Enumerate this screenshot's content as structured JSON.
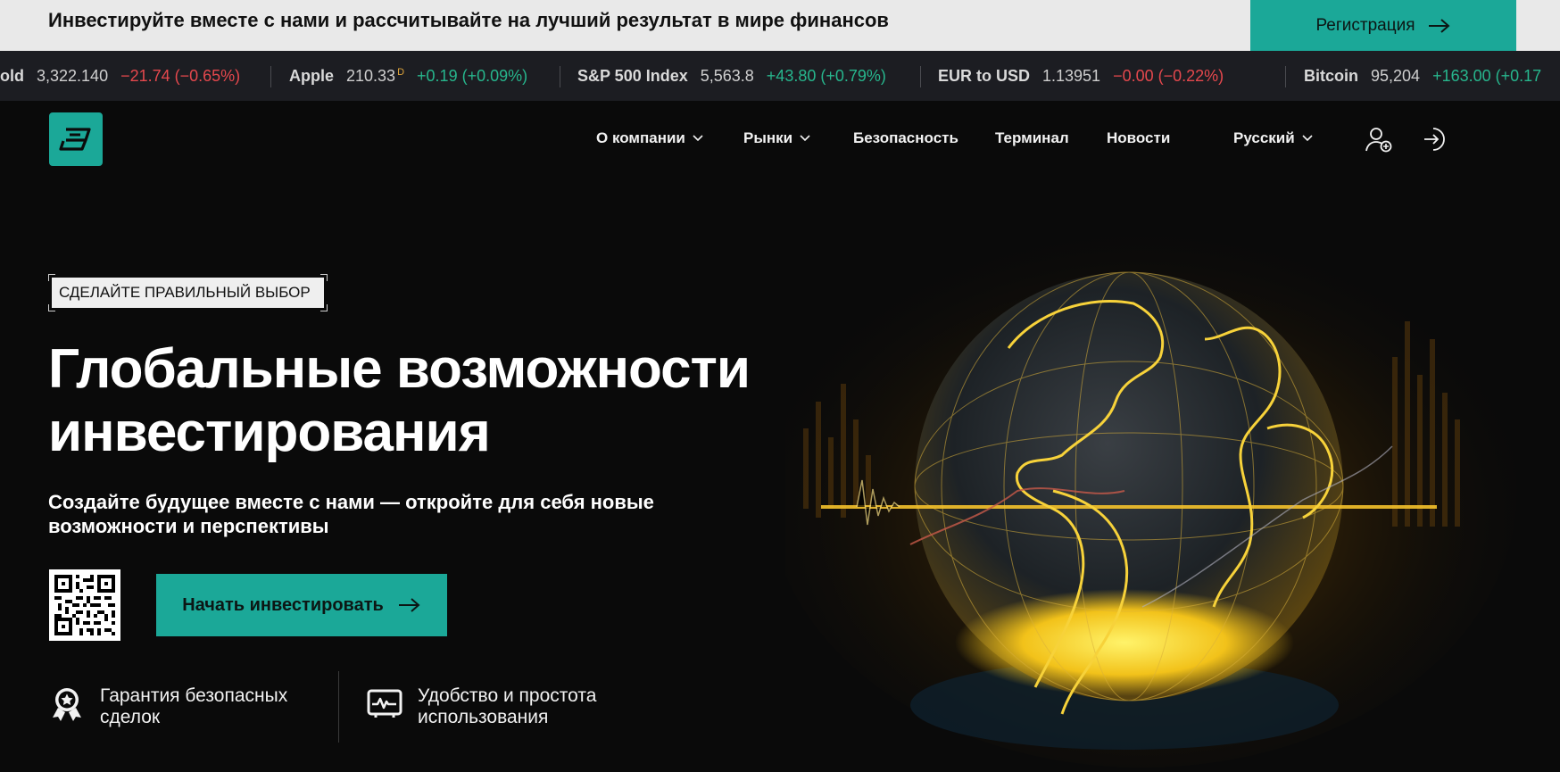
{
  "promo": {
    "text": "Инвестируйте вместе с нами и рассчитывайте на лучший результат в мире финансов",
    "register_label": "Регистрация"
  },
  "ticker": [
    {
      "name": "old",
      "price": "3,322.140",
      "change": "−21.74 (−0.65%)",
      "direction": "down",
      "suffix": ""
    },
    {
      "name": "Apple",
      "price": "210.33",
      "change": "+0.19 (+0.09%)",
      "direction": "up",
      "suffix": "D"
    },
    {
      "name": "S&P 500 Index",
      "price": "5,563.8",
      "change": "+43.80 (+0.79%)",
      "direction": "up",
      "suffix": ""
    },
    {
      "name": "EUR to USD",
      "price": "1.13951",
      "change": "−0.00 (−0.22%)",
      "direction": "down",
      "suffix": ""
    },
    {
      "name": "Bitcoin",
      "price": "95,204",
      "change": "+163.00 (+0.17",
      "direction": "up",
      "suffix": ""
    }
  ],
  "nav": {
    "about": "О компании",
    "markets": "Рынки",
    "security": "Безопасность",
    "terminal": "Терминал",
    "news": "Новости",
    "language": "Русский"
  },
  "hero": {
    "badge": "СДЕЛАЙТЕ ПРАВИЛЬНЫЙ ВЫБОР",
    "title_line1": "Глобальные возможности",
    "title_line2": "инвестирования",
    "subtitle_line1": "Создайте будущее вместе с нами — откройте для себя новые",
    "subtitle_line2": "возможности и перспективы",
    "cta_label": "Начать инвестировать"
  },
  "features": [
    {
      "line1": "Гарантия безопасных",
      "line2": "сделок",
      "icon": "award-badge-icon"
    },
    {
      "line1": "Удобство и простота",
      "line2": "использования",
      "icon": "monitor-chart-icon"
    }
  ],
  "colors": {
    "accent": "#1ba898",
    "background": "#0a0a0a",
    "ticker_bg": "#1c1d22",
    "promo_bg": "#e9e9e9",
    "up": "#27b68d",
    "down": "#e5484d"
  }
}
